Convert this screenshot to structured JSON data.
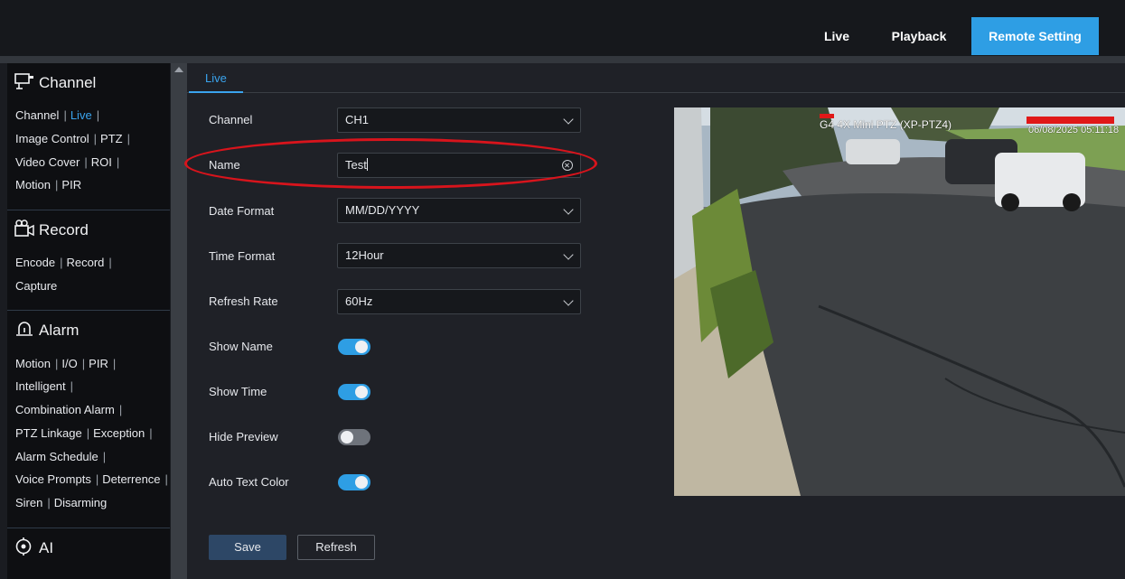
{
  "topnav": {
    "live": "Live",
    "playback": "Playback",
    "remote_setting": "Remote Setting"
  },
  "sidebar": {
    "channel": {
      "title": "Channel",
      "icon": "monitor-camera-icon",
      "rows": [
        [
          "Channel",
          "Live"
        ],
        [
          "Image Control",
          "PTZ"
        ],
        [
          "Video Cover",
          "ROI"
        ],
        [
          "Motion",
          "PIR"
        ]
      ],
      "active": "Live"
    },
    "record": {
      "title": "Record",
      "icon": "video-camera-icon",
      "rows": [
        [
          "Encode",
          "Record"
        ],
        [
          "Capture"
        ]
      ]
    },
    "alarm": {
      "title": "Alarm",
      "icon": "alarm-light-icon",
      "rows": [
        [
          "Motion",
          "I/O",
          "PIR"
        ],
        [
          "Intelligent"
        ],
        [
          "Combination Alarm"
        ],
        [
          "PTZ Linkage",
          "Exception"
        ],
        [
          "Alarm Schedule"
        ],
        [
          "Voice Prompts",
          "Deterrence"
        ],
        [
          "Siren",
          "Disarming"
        ]
      ]
    },
    "ai": {
      "title": "AI",
      "icon": "ai-icon"
    }
  },
  "tab": {
    "live": "Live"
  },
  "form": {
    "channel": {
      "label": "Channel",
      "value": "CH1"
    },
    "name": {
      "label": "Name",
      "value": "Test"
    },
    "date_format": {
      "label": "Date Format",
      "value": "MM/DD/YYYY"
    },
    "time_format": {
      "label": "Time Format",
      "value": "12Hour"
    },
    "refresh_rate": {
      "label": "Refresh Rate",
      "value": "60Hz"
    },
    "show_name": {
      "label": "Show Name",
      "on": true
    },
    "show_time": {
      "label": "Show Time",
      "on": true
    },
    "hide_preview": {
      "label": "Hide Preview",
      "on": false
    },
    "auto_text_color": {
      "label": "Auto Text Color",
      "on": true
    }
  },
  "buttons": {
    "save": "Save",
    "refresh": "Refresh"
  },
  "preview": {
    "osd_name": "G4 4X Mini PTZ (XP-PTZ4)",
    "osd_time": "06/08/2025 05:11:18"
  },
  "colors": {
    "accent": "#2e9ee4",
    "annotation": "#d8141c"
  }
}
